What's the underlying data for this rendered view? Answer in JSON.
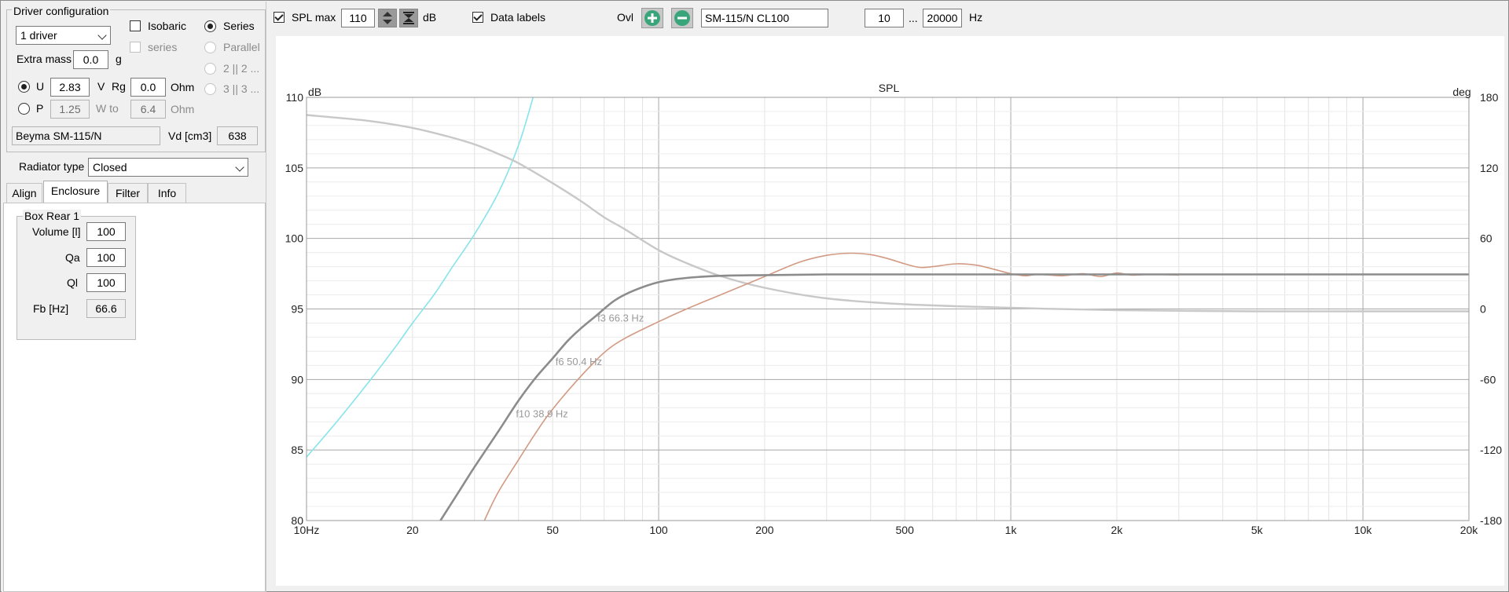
{
  "driver_config": {
    "title": "Driver configuration",
    "drivers_select": "1 driver",
    "isobaric_label": "Isobaric",
    "series_sub_label": "series",
    "series_label": "Series",
    "parallel_label": "Parallel",
    "opt_2x2": "2 || 2 ...",
    "opt_3x3": "3 || 3 ...",
    "extra_mass_label": "Extra mass",
    "extra_mass_value": "0.0",
    "extra_mass_unit": "g",
    "u_label": "U",
    "u_value": "2.83",
    "u_unit": "V",
    "rg_label": "Rg",
    "rg_value": "0.0",
    "rg_unit": "Ohm",
    "p_label": "P",
    "p_value": "1.25",
    "w_to_label": "W to",
    "p_ohm_value": "6.4",
    "p_ohm_unit": "Ohm",
    "driver_name": "Beyma SM-115/N",
    "vd_label": "Vd [cm3]",
    "vd_value": "638"
  },
  "radiator": {
    "label": "Radiator type",
    "value": "Closed"
  },
  "tabs": [
    "Align",
    "Enclosure",
    "Filter",
    "Info"
  ],
  "enclosure": {
    "group_title": "Box Rear 1",
    "volume_label": "Volume [l]",
    "volume_value": "100",
    "qa_label": "Qa",
    "qa_value": "100",
    "ql_label": "Ql",
    "ql_value": "100",
    "fb_label": "Fb [Hz]",
    "fb_value": "66.6"
  },
  "toolbar": {
    "spl_max_label": "SPL max",
    "spl_max_value": "110",
    "db_unit": "dB",
    "data_labels_label": "Data labels",
    "ovl_label": "Ovl",
    "overlay_name": "SM-115/N CL100",
    "freq_min": "10",
    "freq_sep": "...",
    "freq_max": "20000",
    "hz_unit": "Hz"
  },
  "colors": {
    "main_curve": "#8c8c8c",
    "phase_curve": "#c8c8c8",
    "overlay_curve": "#d29a82",
    "excursion_curve": "#86e4ec",
    "plus_button": "#3aa57a",
    "minus_button": "#3aa57a"
  },
  "chart_data": {
    "type": "line",
    "title": "SPL",
    "ylabel": "dB",
    "y2label": "deg",
    "x_scale": "log",
    "xlim": [
      10,
      20000
    ],
    "ylim": [
      80,
      110
    ],
    "y2lim": [
      -180,
      180
    ],
    "x_ticks": [
      {
        "v": 10,
        "label": "10Hz"
      },
      {
        "v": 20,
        "label": "20"
      },
      {
        "v": 50,
        "label": "50"
      },
      {
        "v": 100,
        "label": "100"
      },
      {
        "v": 200,
        "label": "200"
      },
      {
        "v": 500,
        "label": "500"
      },
      {
        "v": 1000,
        "label": "1k"
      },
      {
        "v": 2000,
        "label": "2k"
      },
      {
        "v": 5000,
        "label": "5k"
      },
      {
        "v": 10000,
        "label": "10k"
      },
      {
        "v": 20000,
        "label": "20k"
      }
    ],
    "y_ticks": [
      80,
      85,
      90,
      95,
      100,
      105,
      110
    ],
    "y2_ticks": [
      -180,
      -120,
      -60,
      0,
      60,
      120,
      180
    ],
    "grid": true,
    "series": [
      {
        "key": "spl",
        "x": [
          24,
          27,
          30,
          35,
          40,
          45,
          50,
          55,
          60,
          66.3,
          75,
          85,
          100,
          120,
          150,
          200,
          300,
          500,
          1000,
          2000,
          5000,
          10000,
          20000
        ],
        "y": [
          80,
          82,
          83.8,
          86.3,
          88.5,
          90.2,
          91.5,
          92.7,
          93.6,
          94.5,
          95.6,
          96.3,
          96.9,
          97.2,
          97.35,
          97.4,
          97.45,
          97.45,
          97.45,
          97.45,
          97.45,
          97.45,
          97.45
        ]
      },
      {
        "key": "phase",
        "axis": "right",
        "x": [
          10,
          15,
          20,
          25,
          30,
          35,
          40,
          50,
          60,
          70,
          80,
          100,
          120,
          150,
          200,
          300,
          500,
          1000,
          2000,
          5000,
          10000,
          20000
        ],
        "y": [
          165,
          160,
          154,
          147,
          140,
          132,
          124,
          107,
          92,
          78,
          68,
          50,
          39,
          28,
          18,
          9,
          4,
          1,
          -1,
          -2,
          -2,
          -2
        ]
      },
      {
        "key": "overlay",
        "x": [
          32,
          35,
          40,
          45,
          50,
          60,
          70,
          80,
          100,
          120,
          150,
          200,
          250,
          300,
          350,
          400,
          450,
          500,
          550,
          600,
          700,
          800,
          900,
          1000,
          1100,
          1200,
          1400,
          1600,
          1800,
          2000,
          2200,
          2500,
          3000
        ],
        "y": [
          80,
          82,
          84.3,
          86.3,
          87.9,
          90.2,
          91.9,
          92.9,
          94.1,
          95.0,
          96.0,
          97.3,
          98.3,
          98.8,
          98.95,
          98.85,
          98.55,
          98.2,
          97.95,
          98.0,
          98.2,
          98.1,
          97.8,
          97.5,
          97.35,
          97.45,
          97.35,
          97.5,
          97.3,
          97.55,
          97.4,
          97.45,
          97.4
        ]
      },
      {
        "key": "excursion",
        "x": [
          10,
          12,
          15,
          18,
          20,
          23,
          26,
          30,
          35,
          40,
          44
        ],
        "y": [
          84.5,
          86.8,
          89.8,
          92.4,
          94.0,
          96.0,
          98.0,
          100.3,
          103.2,
          106.6,
          110
        ]
      }
    ],
    "annotations": [
      {
        "text": "f3 66.3 Hz",
        "x": 66.3,
        "y": 94.4
      },
      {
        "text": "f6 50.4 Hz",
        "x": 50.4,
        "y": 91.3
      },
      {
        "text": "f10 38.9 Hz",
        "x": 38.9,
        "y": 87.6
      }
    ]
  }
}
